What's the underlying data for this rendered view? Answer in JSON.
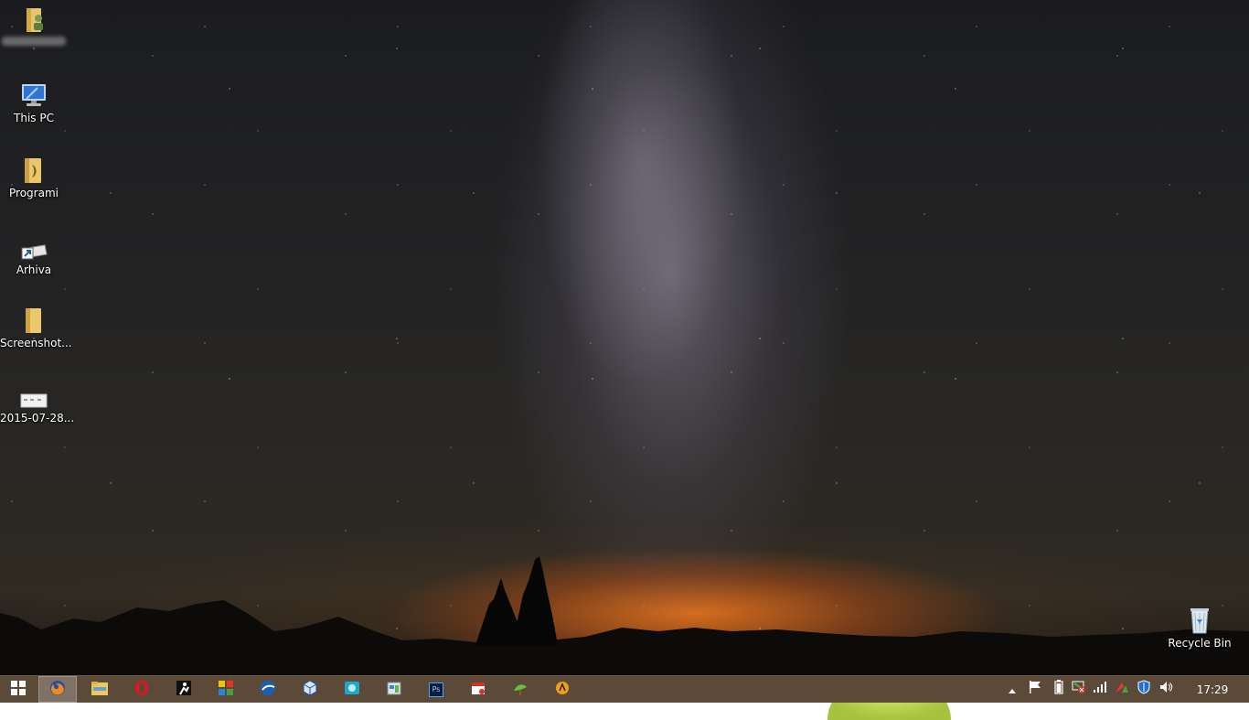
{
  "desktop": {
    "icons": [
      {
        "label": "",
        "icon": "user-folder-icon"
      },
      {
        "label": "This PC",
        "icon": "computer-icon"
      },
      {
        "label": "Programi",
        "icon": "folder-icon"
      },
      {
        "label": "Arhiva",
        "icon": "drive-shortcut-icon"
      },
      {
        "label": "Screenshot...",
        "icon": "folder-icon"
      },
      {
        "label": "2015-07-28...",
        "icon": "image-file-icon"
      },
      {
        "label": "Recycle Bin",
        "icon": "recycle-bin-icon"
      }
    ]
  },
  "taskbar": {
    "color": "#5c4a38",
    "start_icon": "windows-logo-icon",
    "pinned": [
      {
        "icon": "firefox-icon",
        "active": true
      },
      {
        "icon": "file-explorer-icon",
        "active": false
      },
      {
        "icon": "opera-icon",
        "active": false
      },
      {
        "icon": "app-figure-icon",
        "active": false
      },
      {
        "icon": "tiles-app-icon",
        "active": false
      },
      {
        "icon": "globe-app-icon",
        "active": false
      },
      {
        "icon": "virtualbox-icon",
        "active": false
      },
      {
        "icon": "cyan-app-icon",
        "active": false
      },
      {
        "icon": "tools-app-icon",
        "active": false
      },
      {
        "icon": "photoshop-icon",
        "active": false
      },
      {
        "icon": "calendar-app-icon",
        "active": false
      },
      {
        "icon": "plant-app-icon",
        "active": false
      },
      {
        "icon": "orange-app-icon",
        "active": false
      }
    ],
    "photoshop_label": "Ps",
    "tray": {
      "icons": [
        "show-hidden-icons-icon",
        "action-center-flag-icon",
        "battery-icon",
        "network-warning-icon",
        "signal-bars-icon",
        "red-green-app-icon",
        "defender-shield-icon",
        "volume-icon"
      ]
    },
    "clock": "17:29"
  }
}
